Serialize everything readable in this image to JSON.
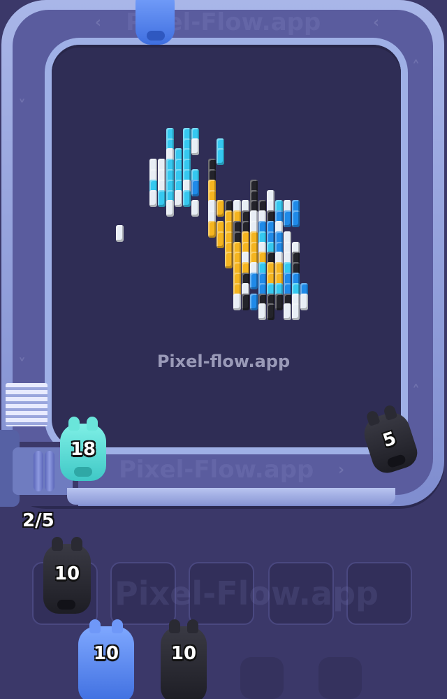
{
  "game": {
    "watermark": "Pixel-flow.app",
    "capacity": "2/5"
  },
  "board": {
    "colors": {
      "cyan": "#35c8f0",
      "blue": "#1f8ae8",
      "white": "#e8eef5",
      "black": "#23232a",
      "yellow": "#f5b520",
      "orange": "#f09a15"
    }
  },
  "conveyor": {
    "pigs": [
      {
        "count": "18",
        "color": "cyan"
      },
      {
        "count": "5",
        "color": "black"
      }
    ]
  },
  "holding_slots": [
    {
      "count": "10",
      "color": "black"
    },
    {
      "count": "",
      "color": ""
    },
    {
      "count": "",
      "color": ""
    },
    {
      "count": "",
      "color": ""
    },
    {
      "count": "",
      "color": ""
    }
  ],
  "queue": [
    {
      "count": "10",
      "color": "blue"
    },
    {
      "count": "10",
      "color": "black"
    }
  ]
}
